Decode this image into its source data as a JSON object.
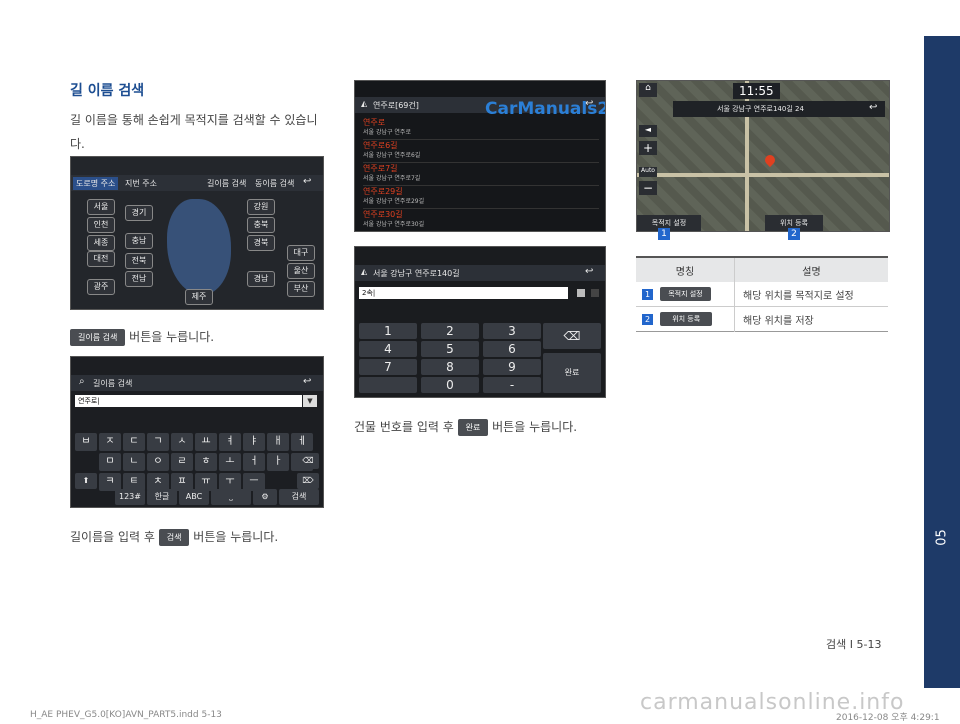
{
  "section": {
    "title": "길 이름 검색",
    "description": "길 이름을 통해 손쉽게 목적지를 검색할 수 있습니다."
  },
  "screen1": {
    "tabs": [
      "도로명 주소",
      "지번 주소",
      "길이름 검색",
      "동이름 검색"
    ],
    "regions": [
      "서울",
      "경기",
      "인천",
      "세종",
      "충남",
      "대전",
      "전북",
      "전남",
      "광주",
      "강원",
      "충북",
      "경북",
      "대구",
      "울산",
      "경남",
      "부산",
      "제주"
    ]
  },
  "caption1": {
    "button": "길이름 검색",
    "text": " 버튼을 누릅니다."
  },
  "screen2": {
    "title": "길이름 검색",
    "input_value": "연주로|",
    "row1": [
      "ㅂ",
      "ㅈ",
      "ㄷ",
      "ㄱ",
      "ㅅ",
      "ㅛ",
      "ㅕ",
      "ㅑ",
      "ㅐ",
      "ㅔ"
    ],
    "row2": [
      "ㅁ",
      "ㄴ",
      "ㅇ",
      "ㄹ",
      "ㅎ",
      "ㅗ",
      "ㅓ",
      "ㅏ",
      "ㅣ"
    ],
    "row3": [
      "ㅋ",
      "ㅌ",
      "ㅊ",
      "ㅍ",
      "ㅠ",
      "ㅜ",
      "ㅡ"
    ],
    "row4": [
      "123#",
      "한글",
      "ABC",
      "검색"
    ]
  },
  "caption2": {
    "prefix": "길이름을 입력 후 ",
    "button": "검색",
    "suffix": " 버튼을 누릅니다."
  },
  "screen3": {
    "title": "연주로[69건]",
    "watermark": "CarManuals2.com",
    "items": [
      {
        "name": "연주로",
        "addr": "서울 강남구 연주로"
      },
      {
        "name": "연주로6길",
        "addr": "서울 강남구 연주로6길"
      },
      {
        "name": "연주로7길",
        "addr": "서울 강남구 연주로7길"
      },
      {
        "name": "연주로29길",
        "addr": "서울 강남구 연주로29길"
      },
      {
        "name": "연주로30길",
        "addr": "서울 강남구 연주로30길"
      }
    ]
  },
  "screen4": {
    "title": "서울 강남구 연주로140길",
    "input_value": "2속|",
    "keys": [
      "1",
      "2",
      "3",
      "4",
      "5",
      "6",
      "7",
      "8",
      "9",
      "0",
      "-"
    ],
    "done": "완료"
  },
  "caption3": {
    "prefix": "건물 번호를 입력 후 ",
    "button": "완료",
    "suffix": " 버튼을 누릅니다."
  },
  "screen5": {
    "time": "11:55",
    "address": "서울 강남구 연주로140길 24",
    "auto": "Auto",
    "btn_left": "목적지 설정",
    "btn_right": "위치 등록",
    "marker1": "1",
    "marker2": "2"
  },
  "table": {
    "headers": [
      "명칭",
      "설명"
    ],
    "rows": [
      {
        "num": "1",
        "button": "목적지 설정",
        "desc": "해당 위치를 목적지로 설정"
      },
      {
        "num": "2",
        "button": "위치 등록",
        "desc": "해당 위치를 저장"
      }
    ]
  },
  "page_label": "검색 I 5-13",
  "chapter_tab": "05",
  "footer_left": "H_AE PHEV_G5.0[KO]AVN_PART5.indd   5-13",
  "footer_right": "2016-12-08   오후 4:29:1",
  "bottom_watermark": "carmanualsonline.info",
  "colors": {
    "navy": "#1e3a68",
    "accent_red": "#e04020",
    "marker_blue": "#2266cc"
  }
}
